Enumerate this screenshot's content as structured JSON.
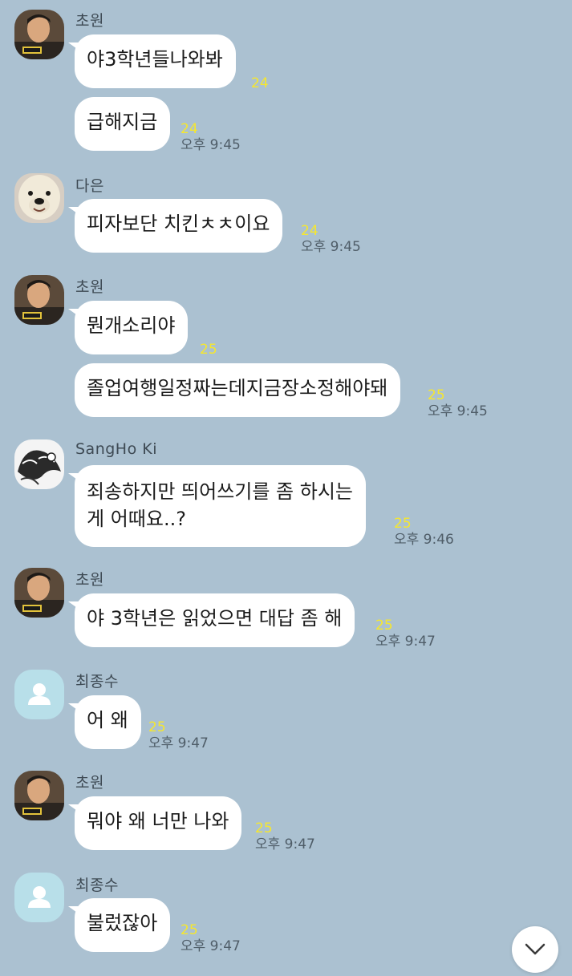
{
  "messages": [
    {
      "sender": "초원",
      "bubbles": [
        {
          "text": "야3학년들나와봐",
          "unread": "24",
          "time": ""
        },
        {
          "text": "급해지금",
          "unread": "24",
          "time": "오후 9:45"
        }
      ]
    },
    {
      "sender": "다은",
      "bubbles": [
        {
          "text": "피자보단 치킨ㅊㅊ이요",
          "unread": "24",
          "time": "오후 9:45"
        }
      ]
    },
    {
      "sender": "초원",
      "bubbles": [
        {
          "text": "뭔개소리야",
          "unread": "25",
          "time": ""
        },
        {
          "text": "졸업여행일정짜는데지금장소정해야돼",
          "unread": "25",
          "time": "오후 9:45"
        }
      ]
    },
    {
      "sender": "SangHo Ki",
      "bubbles": [
        {
          "line1": "죄송하지만 띄어쓰기를 좀 하시는",
          "line2": "게 어때요..?",
          "unread": "25",
          "time": "오후 9:46"
        }
      ]
    },
    {
      "sender": "초원",
      "bubbles": [
        {
          "text": "야 3학년은 읽었으면 대답 좀 해",
          "unread": "25",
          "time": "오후 9:47"
        }
      ]
    },
    {
      "sender": "최종수",
      "bubbles": [
        {
          "text": "어 왜",
          "unread": "25",
          "time": "오후 9:47"
        }
      ]
    },
    {
      "sender": "초원",
      "bubbles": [
        {
          "text": "뭐야 왜 너만 나와",
          "unread": "25",
          "time": "오후 9:47"
        }
      ]
    },
    {
      "sender": "최종수",
      "bubbles": [
        {
          "text": "불렀잖아",
          "unread": "25",
          "time": "오후 9:47"
        }
      ]
    }
  ],
  "icons": {
    "scroll_down": "chevron-down-icon",
    "default_avatar": "person-icon"
  },
  "colors": {
    "background": "#abc1d1",
    "bubble": "#ffffff",
    "unread": "#f6e72e",
    "default_avatar_bg": "#b8dfe9"
  }
}
